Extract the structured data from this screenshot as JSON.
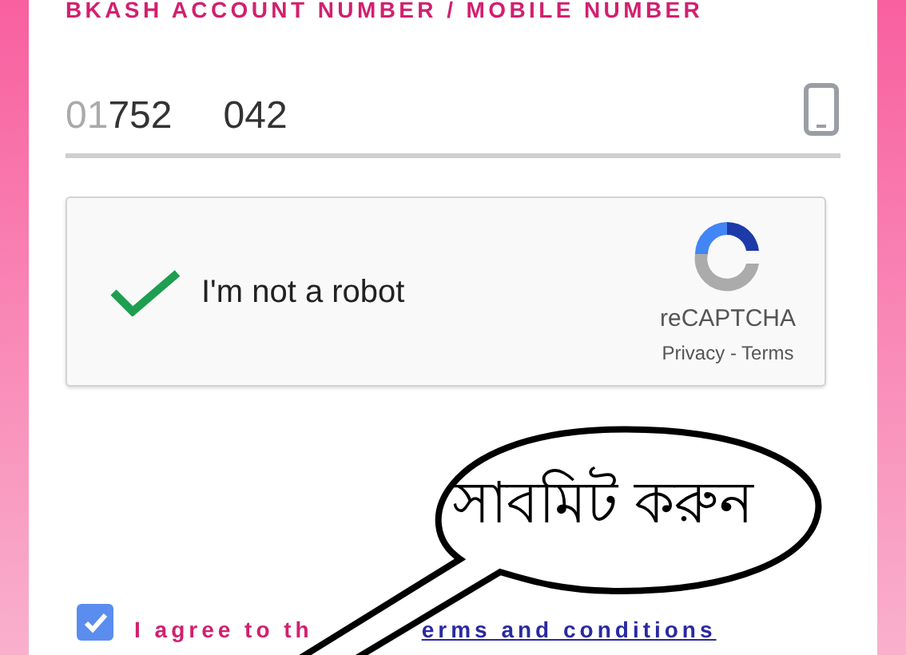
{
  "account_field": {
    "label": "BKASH ACCOUNT NUMBER / MOBILE NUMBER",
    "value_prefix": "01",
    "value_start": "752",
    "value_end": "042"
  },
  "recaptcha": {
    "checked": true,
    "label": "I'm not a robot",
    "brand": "reCAPTCHA",
    "links": "Privacy - Terms"
  },
  "callout": {
    "text": "সাবমিট করুন"
  },
  "agreement": {
    "checked": true,
    "text": "I agree to th",
    "link": "erms and conditions"
  }
}
